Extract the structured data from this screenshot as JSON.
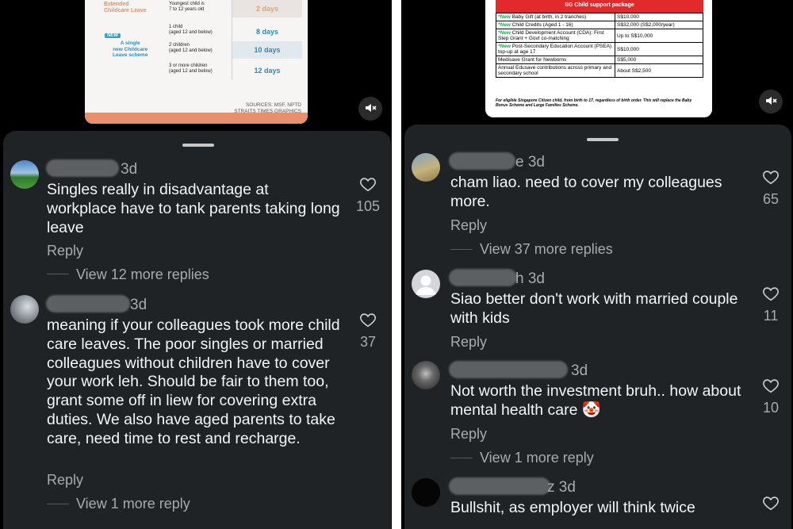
{
  "left": {
    "infographic": {
      "extended_label": "Extended\nChildcare Leave",
      "new_tag": "NEW",
      "new_scheme_label": "A single\nnew Childcare\nLeave scheme",
      "rows": [
        {
          "condition": "Youngest child is\n7 to 12 years old",
          "days": "2 days"
        },
        {
          "condition": "1 child\n(aged 12 and below)",
          "days": "8 days"
        },
        {
          "condition": "2 children\n(aged 12 and below)",
          "days": "10 days"
        },
        {
          "condition": "3 or more children\n(aged 12 and below)",
          "days": "12 days"
        }
      ],
      "sources": "SOURCES: MSF, NPTD\nSTRAITS TIMES GRAPHICS"
    },
    "comments": [
      {
        "time": "3d",
        "text": "Singles really in disadvantage at workplace have to tank parents taking long leave",
        "likes": "105",
        "reply": "Reply",
        "more_replies": "View 12 more replies"
      },
      {
        "time": "3d",
        "text": "meaning if your colleagues took more child care leaves. The poor singles or married colleagues without children have to cover your work leh. Should be fair to them too, grant some off in liew for covering extra duties. We also have aged parents to take care, need time to rest and recharge.",
        "likes": "37",
        "reply": "Reply",
        "more_replies": "View 1 more reply"
      }
    ]
  },
  "right": {
    "table": {
      "title": "SG Child support package",
      "rows": [
        {
          "new": "*New",
          "item": " Baby Gift (at birth, in 2 tranches)",
          "value": "S$10,000"
        },
        {
          "new": "*New",
          "item": " Child Credits (Aged 1 - 16)",
          "value": "S$32,000 (S$2,000/year)"
        },
        {
          "new": "*New",
          "item": " Child Development Account (CDA): First Step Grant + Govt co-matching",
          "value": "Up to S$10,000"
        },
        {
          "new": "*New",
          "item": " Post-Secondary Education Account (PSEA) top-up at age 17",
          "value": "S$10,000"
        },
        {
          "new": "",
          "item": "Medisave Grant for Newborns",
          "value": "S$5,000"
        },
        {
          "new": "",
          "item": "Annual Edusave contributions across primary and secondary school",
          "value": "About S$2,500"
        }
      ],
      "footnote": "For eligible Singapore Citizen child, from birth to 17, regardless of birth order. This will replace the Baby Bonus Scheme and Large Families Scheme."
    },
    "comments": [
      {
        "name_tail": "e",
        "time": "3d",
        "text": "cham liao. need to cover my colleagues more.",
        "likes": "65",
        "reply": "Reply",
        "more_replies": "View 37 more replies"
      },
      {
        "name_tail": "h",
        "time": "3d",
        "text": "Siao better don't work with married couple with kids",
        "likes": "11",
        "reply": "Reply",
        "more_replies": ""
      },
      {
        "name_tail": "",
        "time": "3d",
        "text": "Not worth the investment bruh.. how about mental health care 🤡",
        "likes": "10",
        "reply": "Reply",
        "more_replies": "View 1 more reply"
      },
      {
        "name_tail": "z",
        "time": "3d",
        "text": "Bullshit, as employer will think twice",
        "likes": "",
        "reply": "",
        "more_replies": ""
      }
    ]
  },
  "icons": {
    "mute": "speaker-muted-icon",
    "like": "heart-outline-icon"
  }
}
